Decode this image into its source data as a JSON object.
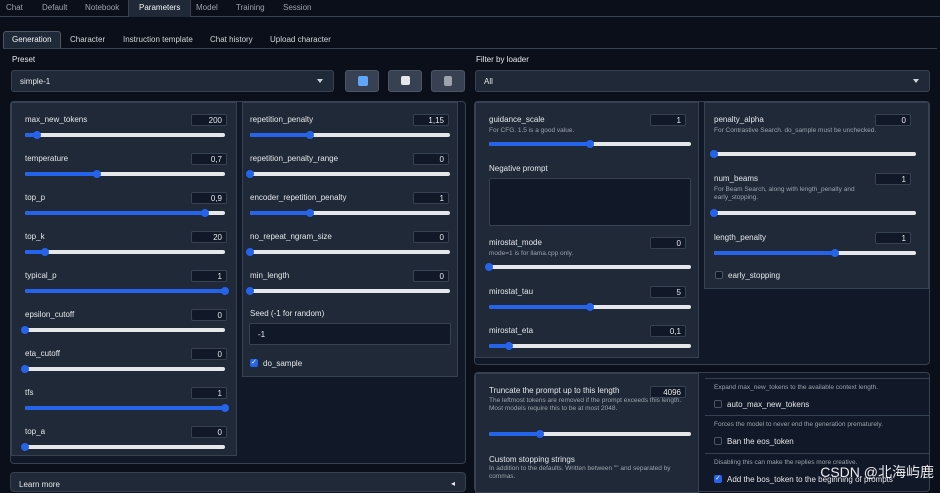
{
  "top_tabs": [
    "Chat",
    "Default",
    "Notebook",
    "Parameters",
    "Model",
    "Training",
    "Session"
  ],
  "active_top_tab": "Parameters",
  "sub_tabs": [
    "Generation",
    "Character",
    "Instruction template",
    "Chat history",
    "Upload character"
  ],
  "active_sub_tab": "Generation",
  "preset": {
    "label": "Preset",
    "value": "simple-1"
  },
  "loader": {
    "label": "Filter by loader",
    "value": "All"
  },
  "preset_buttons": [
    {
      "name": "refresh-icon",
      "color": "#60a5fa"
    },
    {
      "name": "save-icon",
      "color": "#e5e7eb"
    },
    {
      "name": "delete-icon",
      "color": "#9ca3af"
    }
  ],
  "col1": [
    {
      "name": "max_new_tokens",
      "value": "200",
      "fill": 0.06
    },
    {
      "name": "temperature",
      "value": "0,7",
      "fill": 0.36
    },
    {
      "name": "top_p",
      "value": "0,9",
      "fill": 0.9
    },
    {
      "name": "top_k",
      "value": "20",
      "fill": 0.1
    },
    {
      "name": "typical_p",
      "value": "1",
      "fill": 1.0
    },
    {
      "name": "epsilon_cutoff",
      "value": "0",
      "fill": 0.0
    },
    {
      "name": "eta_cutoff",
      "value": "0",
      "fill": 0.0
    },
    {
      "name": "tfs",
      "value": "1",
      "fill": 1.0
    },
    {
      "name": "top_a",
      "value": "0",
      "fill": 0.0
    }
  ],
  "col2": [
    {
      "name": "repetition_penalty",
      "value": "1,15",
      "fill": 0.3
    },
    {
      "name": "repetition_penalty_range",
      "value": "0",
      "fill": 0.0
    },
    {
      "name": "encoder_repetition_penalty",
      "value": "1",
      "fill": 0.3
    },
    {
      "name": "no_repeat_ngram_size",
      "value": "0",
      "fill": 0.0
    },
    {
      "name": "min_length",
      "value": "0",
      "fill": 0.0
    }
  ],
  "seed": {
    "label": "Seed (-1 for random)",
    "value": "-1"
  },
  "do_sample": {
    "label": "do_sample",
    "checked": true
  },
  "col3": [
    {
      "name": "guidance_scale",
      "value": "1",
      "desc": "For CFG. 1.5 is a good value.",
      "fill": 0.5
    },
    {
      "name": "mirostat_mode",
      "value": "0",
      "desc": "mode=1 is for llama.cpp only.",
      "fill": 0.0
    },
    {
      "name": "mirostat_tau",
      "value": "5",
      "desc": "",
      "fill": 0.5
    },
    {
      "name": "mirostat_eta",
      "value": "0,1",
      "desc": "",
      "fill": 0.1
    }
  ],
  "negative_prompt": {
    "label": "Negative prompt",
    "value": ""
  },
  "col4": [
    {
      "name": "penalty_alpha",
      "value": "0",
      "desc": "For Contrastive Search. do_sample must be unchecked.",
      "fill": 0.0
    },
    {
      "name": "num_beams",
      "value": "1",
      "desc": "For Beam Search, along with length_penalty and early_stopping.",
      "fill": 0.0
    },
    {
      "name": "length_penalty",
      "value": "1",
      "desc": "",
      "fill": 0.6
    }
  ],
  "early_stopping": {
    "label": "early_stopping",
    "checked": false
  },
  "truncate": {
    "name": "Truncate the prompt up to this length",
    "value": "4096",
    "desc": "The leftmost tokens are removed if the prompt exceeds this length. Most models require this to be at most 2048.",
    "fill": 0.25
  },
  "stopping": {
    "label": "Custom stopping strings",
    "desc": "In addition to the defaults. Written between \"\" and separated by commas."
  },
  "right_opts": [
    {
      "info": "Expand max_new_tokens to the available context length.",
      "label": "auto_max_new_tokens",
      "checked": false
    },
    {
      "info": "Forces the model to never end the generation prematurely.",
      "label": "Ban the eos_token",
      "checked": false
    },
    {
      "info": "Disabling this can make the replies more creative.",
      "label": "Add the bos_token to the beginning of prompts",
      "checked": true
    }
  ],
  "learn_more": "Learn more",
  "watermark": "CSDN @北海屿鹿"
}
